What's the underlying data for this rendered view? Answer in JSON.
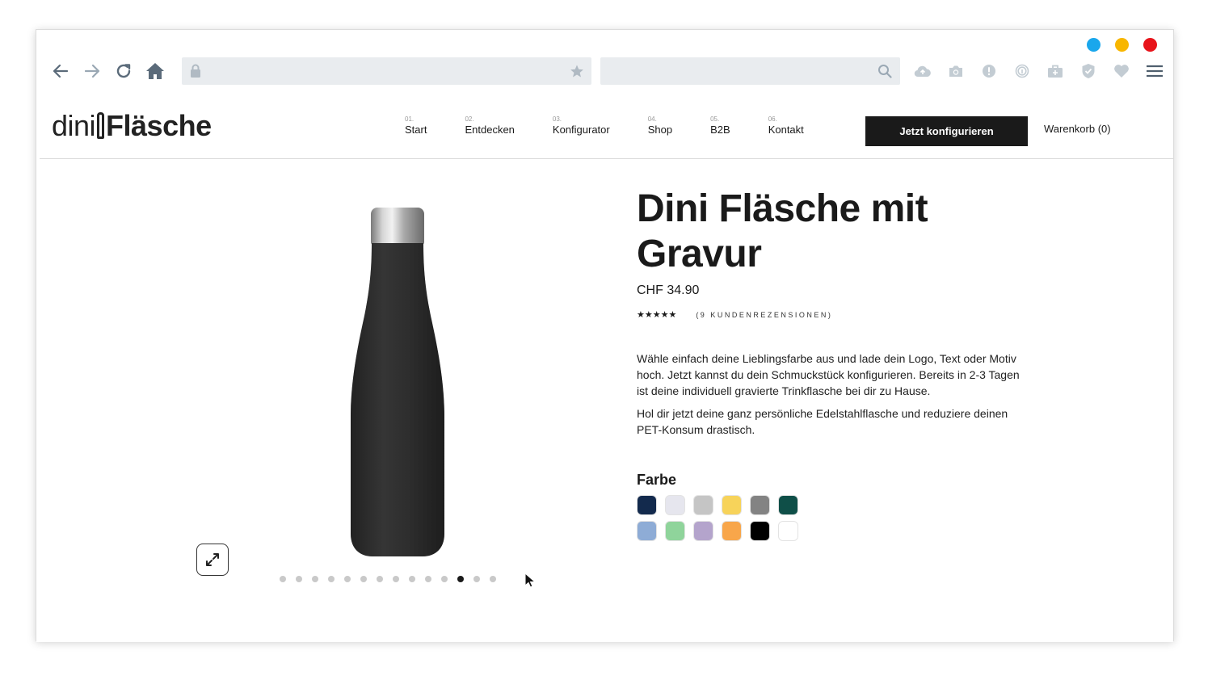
{
  "window": {
    "dot_colors": [
      "#1aa7ec",
      "#f8b600",
      "#e8141b"
    ]
  },
  "toolbar": {
    "icons": [
      "back-arrow-icon",
      "forward-arrow-icon",
      "reload-icon",
      "home-icon",
      "lock-icon",
      "star-icon",
      "search-icon",
      "cloud-upload-icon",
      "camera-icon",
      "alert-icon",
      "fingerprint-icon",
      "briefcase-icon",
      "shield-check-icon",
      "heart-icon",
      "hamburger-menu-icon"
    ],
    "url": "",
    "search_value": ""
  },
  "header": {
    "logo_part1": "dini",
    "logo_part2": "Fläsche",
    "nav": [
      {
        "num": "01.",
        "label": "Start"
      },
      {
        "num": "02.",
        "label": "Entdecken"
      },
      {
        "num": "03.",
        "label": "Konfigurator"
      },
      {
        "num": "04.",
        "label": "Shop"
      },
      {
        "num": "05.",
        "label": "B2B"
      },
      {
        "num": "06.",
        "label": "Kontakt"
      }
    ],
    "cta_label": "Jetzt konfigurieren",
    "cart_label": "Warenkorb (0)"
  },
  "product": {
    "title": "Dini Fläsche mit Gravur",
    "price": "CHF 34.90",
    "rating_stars": 5,
    "stars_text": "★★★★★",
    "reviews_text": "(9 KUNDENREZENSIONEN)",
    "description": [
      "Wähle einfach deine Lieblingsfarbe aus und lade dein Logo, Text oder Motiv hoch. Jetzt kannst du dein Schmuckstück konfigurieren. Bereits in 2-3 Tagen ist deine individuell gravierte Trinkflasche bei dir zu Hause.",
      "Hol dir jetzt deine ganz persönliche Edelstahlflasche und reduziere deinen PET-Konsum drastisch."
    ],
    "color_label": "Farbe",
    "colors": [
      "#132a4d",
      "#e6e6ee",
      "#c5c5c5",
      "#f7d35a",
      "#838383",
      "#0f4f48",
      "#8eacd6",
      "#8fd49b",
      "#b4a4cc",
      "#f8a64a",
      "#000000",
      "#ffffff"
    ],
    "bottle_color": "#2e2e2e",
    "gallery": {
      "total": 14,
      "active_index": 11
    }
  }
}
